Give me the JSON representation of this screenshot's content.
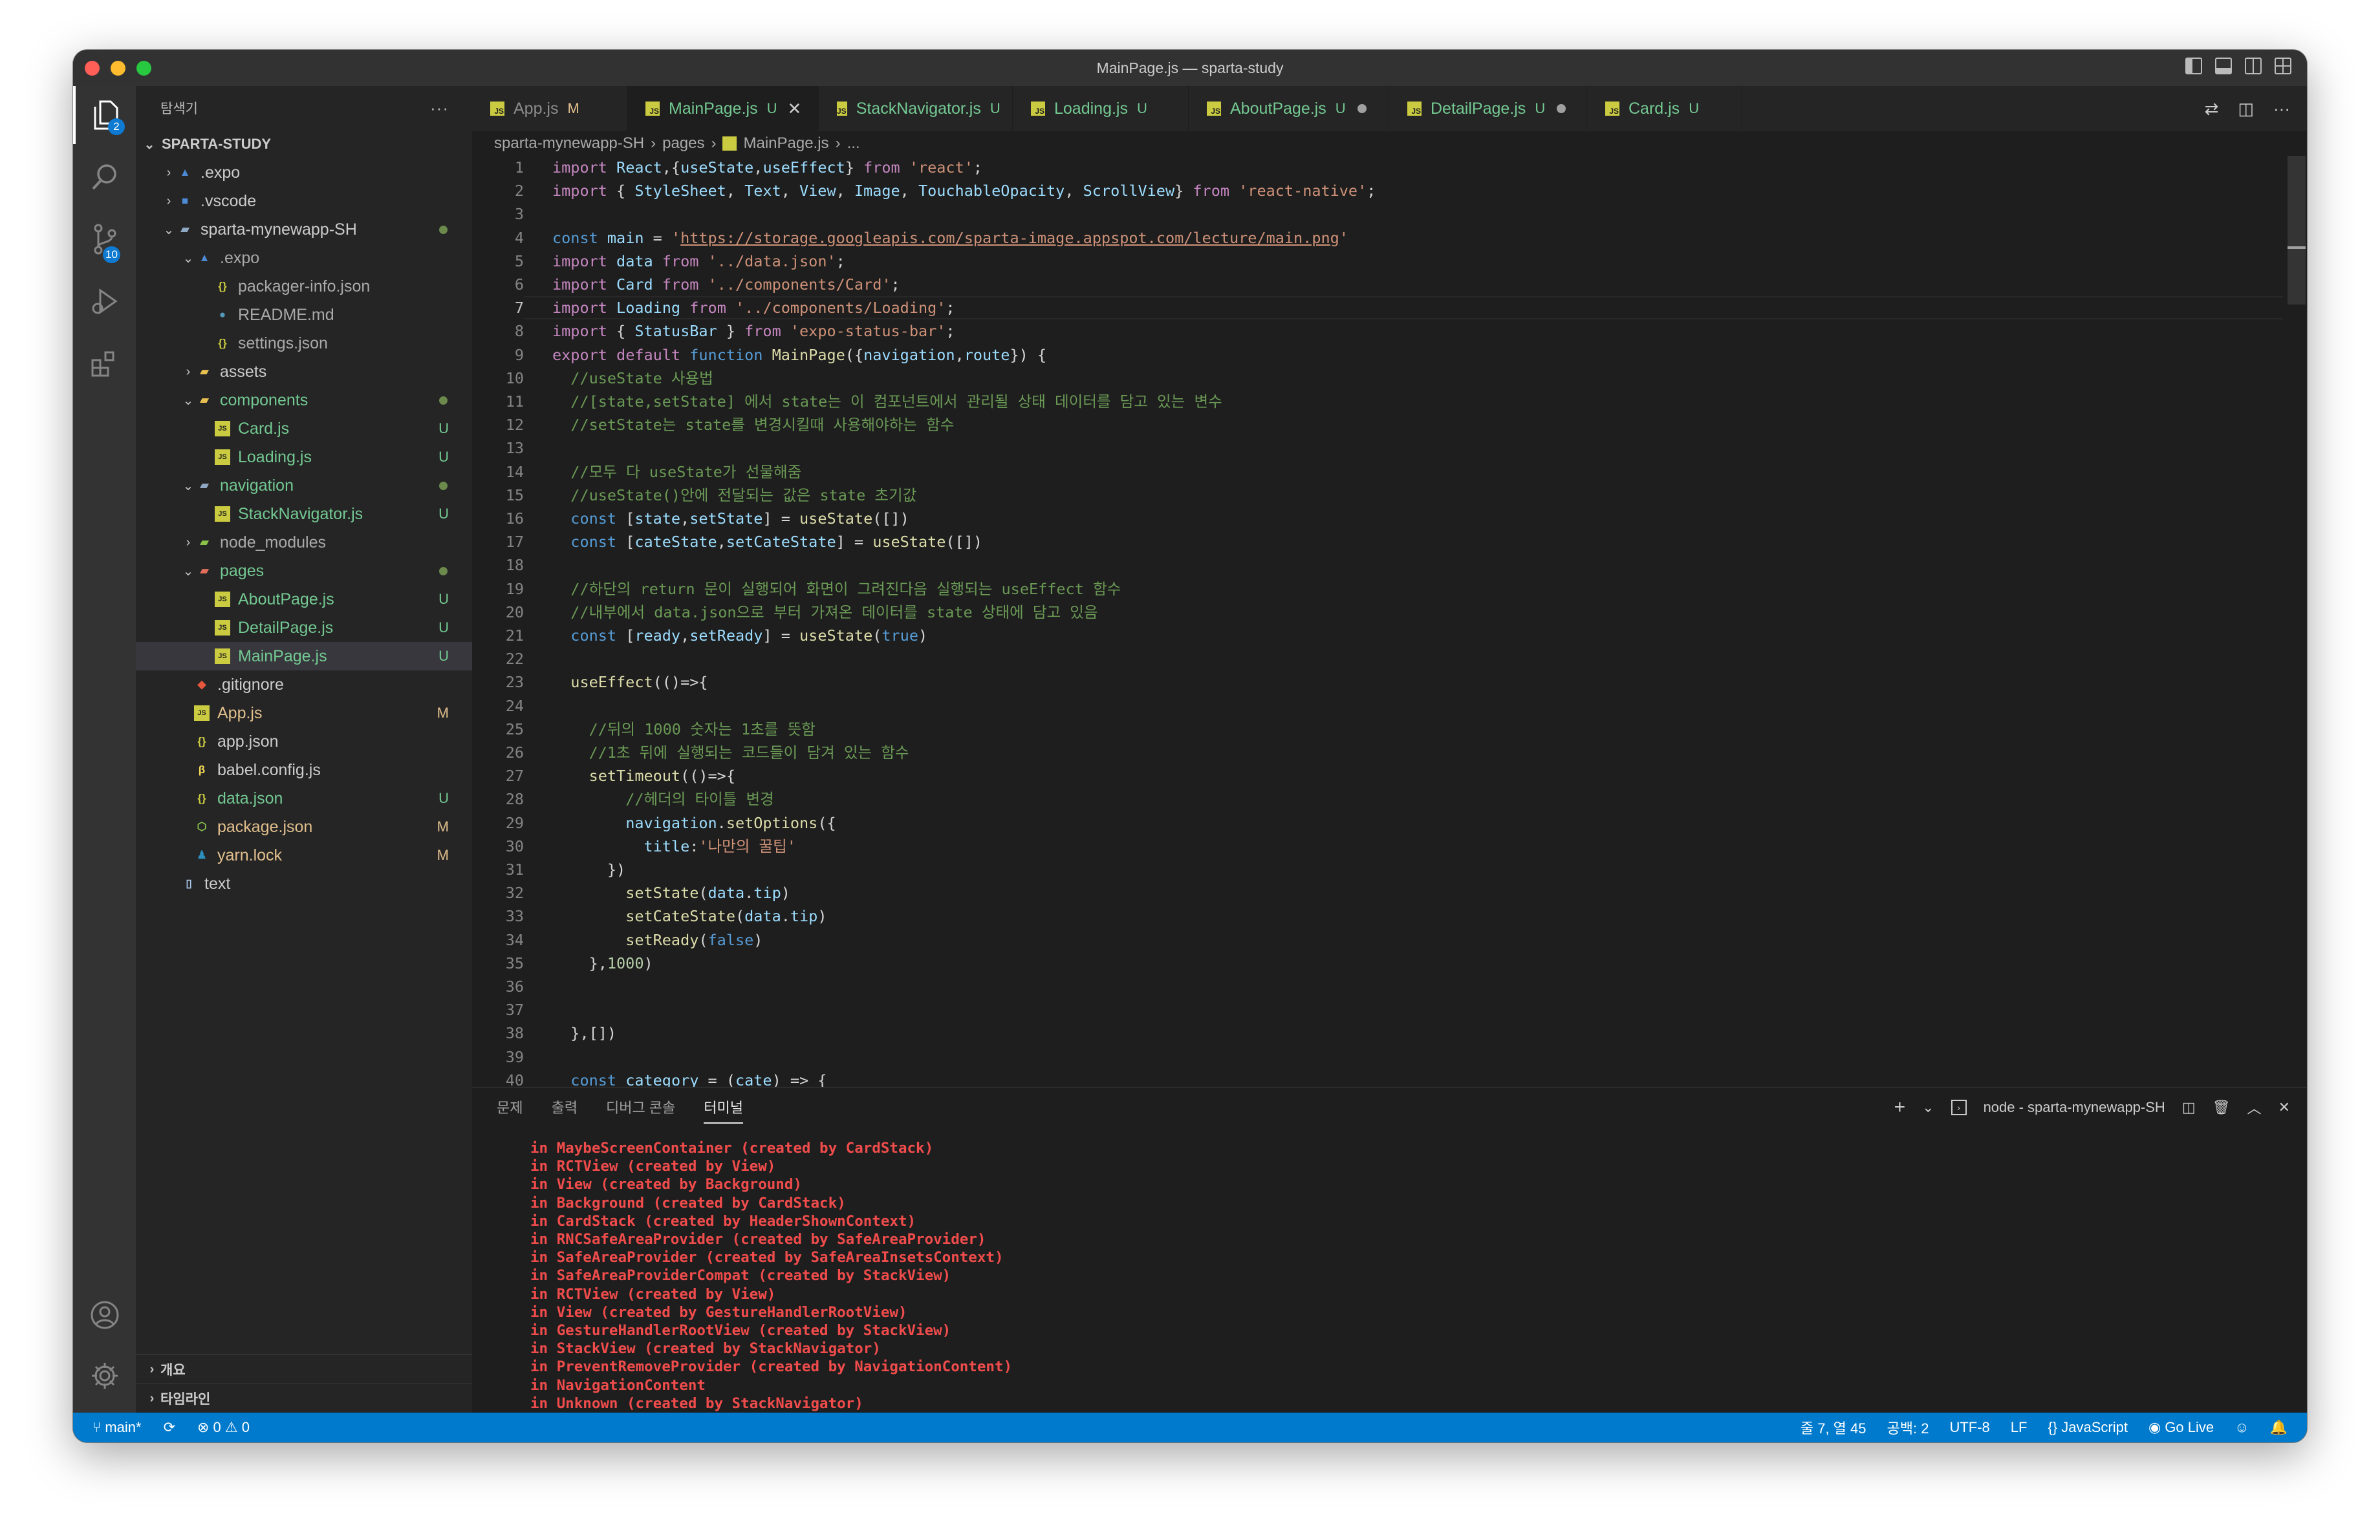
{
  "window": {
    "title": "MainPage.js — sparta-study"
  },
  "activity_bar": {
    "explorer_badge": "2",
    "scm_badge": "10"
  },
  "explorer": {
    "header": "탐색기",
    "more": "···",
    "project": "SPARTA-STUDY",
    "items": [
      {
        "label": ".expo",
        "status": ""
      },
      {
        "label": ".vscode",
        "status": ""
      },
      {
        "label": "sparta-mynewapp-SH",
        "status": ""
      },
      {
        "label": ".expo",
        "status": ""
      },
      {
        "label": "packager-info.json",
        "status": ""
      },
      {
        "label": "README.md",
        "status": ""
      },
      {
        "label": "settings.json",
        "status": ""
      },
      {
        "label": "assets",
        "status": ""
      },
      {
        "label": "components",
        "status": ""
      },
      {
        "label": "Card.js",
        "status": "U"
      },
      {
        "label": "Loading.js",
        "status": "U"
      },
      {
        "label": "navigation",
        "status": ""
      },
      {
        "label": "StackNavigator.js",
        "status": "U"
      },
      {
        "label": "node_modules",
        "status": ""
      },
      {
        "label": "pages",
        "status": ""
      },
      {
        "label": "AboutPage.js",
        "status": "U"
      },
      {
        "label": "DetailPage.js",
        "status": "U"
      },
      {
        "label": "MainPage.js",
        "status": "U"
      },
      {
        "label": ".gitignore",
        "status": ""
      },
      {
        "label": "App.js",
        "status": "M"
      },
      {
        "label": "app.json",
        "status": ""
      },
      {
        "label": "babel.config.js",
        "status": ""
      },
      {
        "label": "data.json",
        "status": "U"
      },
      {
        "label": "package.json",
        "status": "M"
      },
      {
        "label": "yarn.lock",
        "status": "M"
      },
      {
        "label": "text",
        "status": ""
      }
    ],
    "outline": "개요",
    "timeline": "타임라인"
  },
  "tabs": [
    {
      "label": "App.js",
      "status": "M"
    },
    {
      "label": "MainPage.js",
      "status": "U"
    },
    {
      "label": "StackNavigator.js",
      "status": "U"
    },
    {
      "label": "Loading.js",
      "status": "U"
    },
    {
      "label": "AboutPage.js",
      "status": "U"
    },
    {
      "label": "DetailPage.js",
      "status": "U"
    },
    {
      "label": "Card.js",
      "status": "U"
    }
  ],
  "breadcrumb": {
    "root": "sparta-mynewapp-SH",
    "folder": "pages",
    "file": "MainPage.js",
    "more": "..."
  },
  "code": {
    "line_numbers": [
      "1",
      "2",
      "3",
      "4",
      "5",
      "6",
      "7",
      "8",
      "9",
      "10",
      "11",
      "12",
      "13",
      "14",
      "15",
      "16",
      "17",
      "18",
      "19",
      "20",
      "21",
      "22",
      "23",
      "24",
      "25",
      "26",
      "27",
      "28",
      "29",
      "30",
      "31",
      "32",
      "33",
      "34",
      "35",
      "36",
      "37",
      "38",
      "39",
      "40"
    ],
    "current_line": "7",
    "lines": [
      "import React,{useState,useEffect} from 'react';",
      "import { StyleSheet, Text, View, Image, TouchableOpacity, ScrollView} from 'react-native';",
      "",
      "const main = 'https://storage.googleapis.com/sparta-image.appspot.com/lecture/main.png'",
      "import data from '../data.json';",
      "import Card from '../components/Card';",
      "import Loading from '../components/Loading';",
      "import { StatusBar } from 'expo-status-bar';",
      "export default function MainPage({navigation,route}) {",
      "  //useState 사용법",
      "  //[state,setState] 에서 state는 이 컴포넌트에서 관리될 상태 데이터를 담고 있는 변수",
      "  //setState는 state를 변경시킬때 사용해야하는 함수",
      "",
      "  //모두 다 useState가 선물해줌",
      "  //useState()안에 전달되는 값은 state 초기값",
      "  const [state,setState] = useState([])",
      "  const [cateState,setCateState] = useState([])",
      "",
      "  //하단의 return 문이 실행되어 화면이 그려진다음 실행되는 useEffect 함수",
      "  //내부에서 data.json으로 부터 가져온 데이터를 state 상태에 담고 있음",
      "  const [ready,setReady] = useState(true)",
      "",
      "  useEffect(()=>{",
      "",
      "    //뒤의 1000 숫자는 1초를 뜻함",
      "    //1초 뒤에 실행되는 코드들이 담겨 있는 함수",
      "    setTimeout(()=>{",
      "        //헤더의 타이틀 변경",
      "        navigation.setOptions({",
      "          title:'나만의 꿀팁'",
      "      })",
      "        setState(data.tip)",
      "        setCateState(data.tip)",
      "        setReady(false)",
      "    },1000)",
      "",
      "",
      "  },[])",
      "",
      "  const category = (cate) => {"
    ]
  },
  "panel": {
    "tabs": [
      "문제",
      "출력",
      "디버그 콘솔",
      "터미널"
    ],
    "active_tab": "터미널",
    "terminal_name": "node - sparta-mynewapp-SH",
    "output": [
      "in MaybeScreenContainer (created by CardStack)",
      "in RCTView (created by View)",
      "in View (created by Background)",
      "in Background (created by CardStack)",
      "in CardStack (created by HeaderShownContext)",
      "in RNCSafeAreaProvider (created by SafeAreaProvider)",
      "in SafeAreaProvider (created by SafeAreaInsetsContext)",
      "in SafeAreaProviderCompat (created by StackView)",
      "in RCTView (created by View)",
      "in View (created by GestureHandlerRootView)",
      "in GestureHandlerRootView (created by StackView)",
      "in StackView (created by StackNavigator)",
      "in PreventRemoveProvider (created by NavigationContent)",
      "in NavigationContent",
      "in Unknown (created by StackNavigator)"
    ]
  },
  "statusbar": {
    "branch": "main*",
    "errors": "0",
    "warnings": "0",
    "position": "줄 7, 열 45",
    "spaces": "공백: 2",
    "encoding": "UTF-8",
    "eol": "LF",
    "language": "JavaScript",
    "golive": "Go Live"
  },
  "colors": {
    "accent": "#007acc",
    "untracked": "#73c991",
    "modified": "#e2c08d",
    "error": "#f14c4c"
  }
}
